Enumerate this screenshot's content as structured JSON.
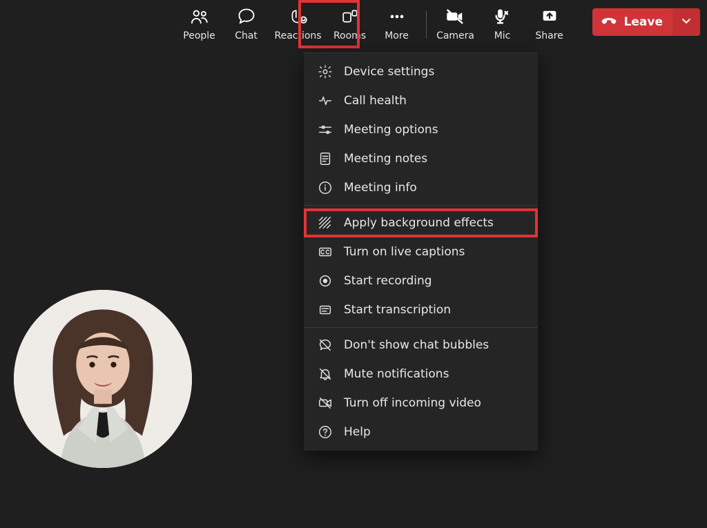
{
  "toolbar": {
    "people": {
      "label": "People"
    },
    "chat": {
      "label": "Chat"
    },
    "reactions": {
      "label": "Reactions"
    },
    "rooms": {
      "label": "Rooms"
    },
    "more": {
      "label": "More"
    },
    "camera": {
      "label": "Camera"
    },
    "mic": {
      "label": "Mic"
    },
    "share": {
      "label": "Share"
    },
    "leave": {
      "label": "Leave"
    }
  },
  "more_menu": {
    "items": [
      {
        "icon": "gear",
        "label": "Device settings"
      },
      {
        "icon": "pulse",
        "label": "Call health"
      },
      {
        "icon": "sliders",
        "label": "Meeting options"
      },
      {
        "icon": "notes",
        "label": "Meeting notes"
      },
      {
        "icon": "info",
        "label": "Meeting info"
      },
      {
        "icon": "effects",
        "label": "Apply background effects"
      },
      {
        "icon": "cc",
        "label": "Turn on live captions"
      },
      {
        "icon": "record",
        "label": "Start recording"
      },
      {
        "icon": "transcript",
        "label": "Start transcription"
      },
      {
        "icon": "chat-off",
        "label": "Don't show chat bubbles"
      },
      {
        "icon": "bell-off",
        "label": "Mute notifications"
      },
      {
        "icon": "video-off",
        "label": "Turn off incoming video"
      },
      {
        "icon": "help",
        "label": "Help"
      }
    ],
    "section_breaks_after": [
      4,
      8
    ],
    "highlighted_index": 5
  },
  "annotations": {
    "more_button_highlight": true
  },
  "participants": {
    "self_avatar_visible": true
  }
}
